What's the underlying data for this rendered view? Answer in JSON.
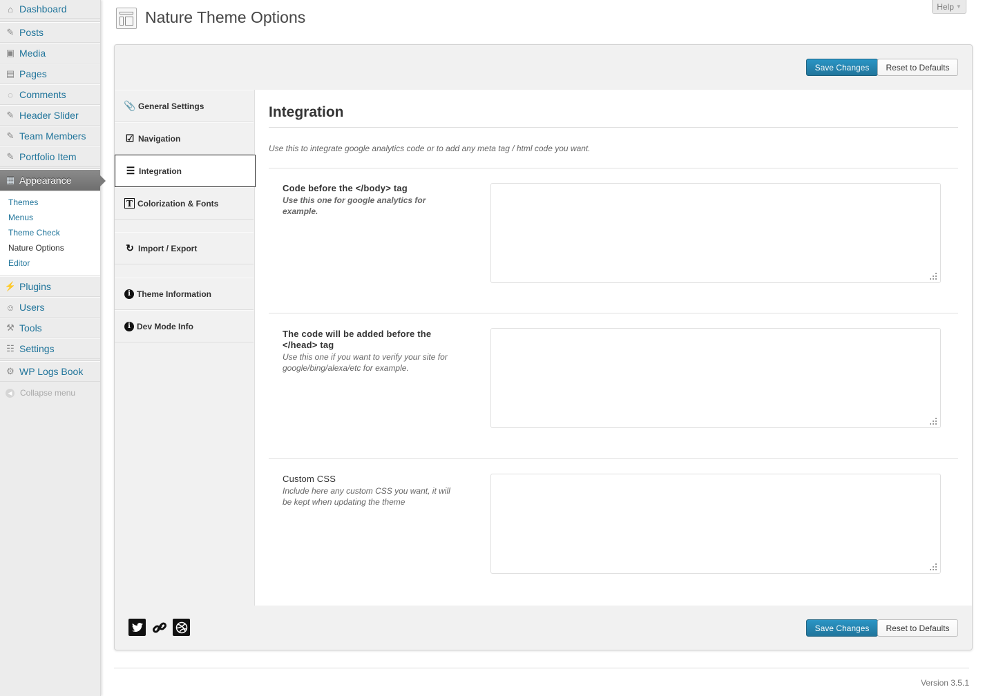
{
  "sidebar": {
    "items": [
      {
        "label": "Dashboard",
        "icon": "dashboard-icon"
      },
      {
        "label": "Posts",
        "icon": "pin-icon"
      },
      {
        "label": "Media",
        "icon": "media-icon"
      },
      {
        "label": "Pages",
        "icon": "pages-icon"
      },
      {
        "label": "Comments",
        "icon": "comment-icon"
      },
      {
        "label": "Header Slider",
        "icon": "pin-icon"
      },
      {
        "label": "Team Members",
        "icon": "pin-icon"
      },
      {
        "label": "Portfolio Item",
        "icon": "pin-icon"
      },
      {
        "label": "Appearance",
        "icon": "appearance-icon"
      },
      {
        "label": "Plugins",
        "icon": "plug-icon"
      },
      {
        "label": "Users",
        "icon": "users-icon"
      },
      {
        "label": "Tools",
        "icon": "tools-icon"
      },
      {
        "label": "Settings",
        "icon": "settings-icon"
      },
      {
        "label": "WP Logs Book",
        "icon": "gear-icon"
      }
    ],
    "appearance_submenu": [
      "Themes",
      "Menus",
      "Theme Check",
      "Nature Options",
      "Editor"
    ],
    "collapse_label": "Collapse menu"
  },
  "header": {
    "title": "Nature Theme Options",
    "help_label": "Help"
  },
  "buttons": {
    "save": "Save Changes",
    "reset": "Reset to Defaults"
  },
  "tabs": [
    {
      "label": "General Settings",
      "icon": "paperclip-icon"
    },
    {
      "label": "Navigation",
      "icon": "checkbox-icon"
    },
    {
      "label": "Integration",
      "icon": "menu-lines-icon"
    },
    {
      "label": "Colorization & Fonts",
      "icon": "text-icon"
    },
    {
      "label": "Import / Export",
      "icon": "refresh-icon"
    },
    {
      "label": "Theme Information",
      "icon": "info-icon"
    },
    {
      "label": "Dev Mode Info",
      "icon": "info-icon"
    }
  ],
  "section": {
    "title": "Integration",
    "description": "Use this to integrate google analytics code or to add any meta tag / html code you want.",
    "options": [
      {
        "title": "Code before the </body> tag",
        "desc": "Use this one for google analytics for example.",
        "value": ""
      },
      {
        "title": "The code will be added before the </head> tag",
        "desc": "Use this one if you want to verify your site for google/bing/alexa/etc for example.",
        "value": ""
      },
      {
        "title": "Custom CSS",
        "desc": "Include here any custom CSS you want, it will be kept when updating the theme",
        "value": ""
      }
    ]
  },
  "social": [
    "twitter-icon",
    "link-icon",
    "dribbble-icon"
  ],
  "footer": {
    "version": "Version 3.5.1"
  },
  "colors": {
    "primary_button": "#21759b",
    "menu_link": "#21759b",
    "current_menu": "#777777"
  }
}
